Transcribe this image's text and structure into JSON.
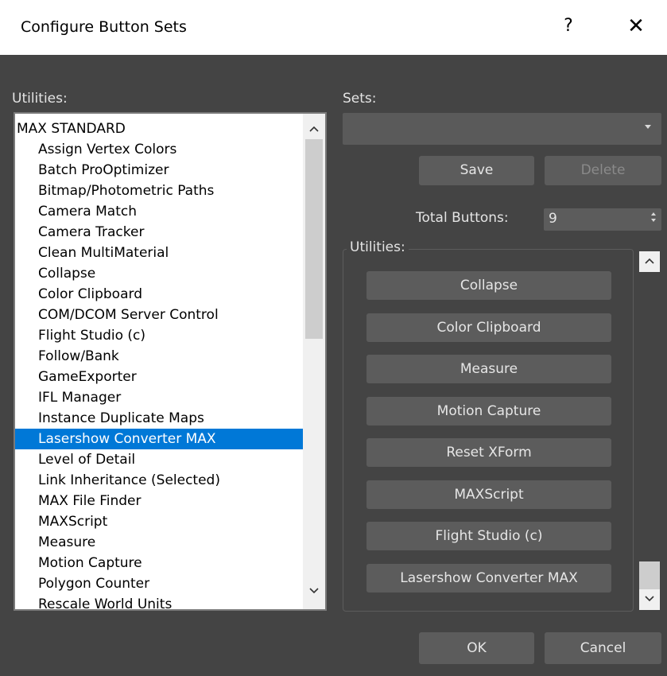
{
  "window": {
    "title": "Configure Button Sets",
    "help_label": "?",
    "close_label": "✕"
  },
  "utilities_label": "Utilities:",
  "utilities_list": {
    "items": [
      {
        "label": "MAX STANDARD",
        "group": true,
        "selected": false
      },
      {
        "label": "Assign Vertex Colors",
        "group": false,
        "selected": false
      },
      {
        "label": "Batch ProOptimizer",
        "group": false,
        "selected": false
      },
      {
        "label": "Bitmap/Photometric Paths",
        "group": false,
        "selected": false
      },
      {
        "label": "Camera Match",
        "group": false,
        "selected": false
      },
      {
        "label": "Camera Tracker",
        "group": false,
        "selected": false
      },
      {
        "label": "Clean MultiMaterial",
        "group": false,
        "selected": false
      },
      {
        "label": "Collapse",
        "group": false,
        "selected": false
      },
      {
        "label": "Color Clipboard",
        "group": false,
        "selected": false
      },
      {
        "label": "COM/DCOM Server Control",
        "group": false,
        "selected": false
      },
      {
        "label": "Flight Studio (c)",
        "group": false,
        "selected": false
      },
      {
        "label": "Follow/Bank",
        "group": false,
        "selected": false
      },
      {
        "label": "GameExporter",
        "group": false,
        "selected": false
      },
      {
        "label": "IFL Manager",
        "group": false,
        "selected": false
      },
      {
        "label": "Instance Duplicate Maps",
        "group": false,
        "selected": false
      },
      {
        "label": "Lasershow Converter MAX",
        "group": false,
        "selected": true
      },
      {
        "label": "Level of Detail",
        "group": false,
        "selected": false
      },
      {
        "label": "Link Inheritance (Selected)",
        "group": false,
        "selected": false
      },
      {
        "label": "MAX File Finder",
        "group": false,
        "selected": false
      },
      {
        "label": "MAXScript",
        "group": false,
        "selected": false
      },
      {
        "label": "Measure",
        "group": false,
        "selected": false
      },
      {
        "label": "Motion Capture",
        "group": false,
        "selected": false
      },
      {
        "label": "Polygon Counter",
        "group": false,
        "selected": false
      },
      {
        "label": "Rescale World Units",
        "group": false,
        "selected": false
      }
    ]
  },
  "sets": {
    "label": "Sets:",
    "value": "",
    "save_label": "Save",
    "delete_label": "Delete"
  },
  "total_buttons": {
    "label": "Total Buttons:",
    "value": "9"
  },
  "utilities_group": {
    "legend": "Utilities:",
    "buttons": [
      "Collapse",
      "Color Clipboard",
      "Measure",
      "Motion Capture",
      "Reset XForm",
      "MAXScript",
      "Flight Studio (c)",
      "Lasershow Converter MAX"
    ]
  },
  "footer": {
    "ok_label": "OK",
    "cancel_label": "Cancel"
  },
  "colors": {
    "background": "#444444",
    "button": "#5c5c5c",
    "selection": "#0078d7",
    "text": "#e4e4e4"
  },
  "icons": {
    "scroll_up": "chevron-up-icon",
    "scroll_down": "chevron-down-icon",
    "dropdown": "caret-down-icon",
    "spinner": "spinner-arrows-icon"
  }
}
